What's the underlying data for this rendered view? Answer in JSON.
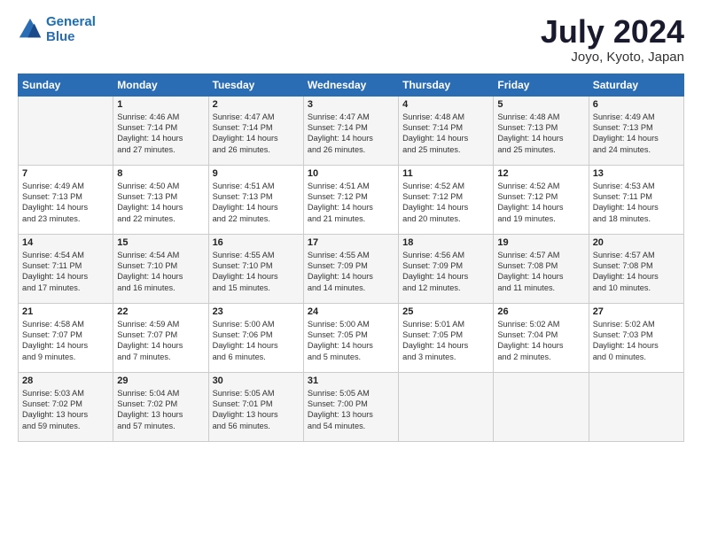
{
  "header": {
    "logo_line1": "General",
    "logo_line2": "Blue",
    "month": "July 2024",
    "location": "Joyo, Kyoto, Japan"
  },
  "days_of_week": [
    "Sunday",
    "Monday",
    "Tuesday",
    "Wednesday",
    "Thursday",
    "Friday",
    "Saturday"
  ],
  "weeks": [
    [
      {
        "day": "",
        "content": ""
      },
      {
        "day": "1",
        "content": "Sunrise: 4:46 AM\nSunset: 7:14 PM\nDaylight: 14 hours\nand 27 minutes."
      },
      {
        "day": "2",
        "content": "Sunrise: 4:47 AM\nSunset: 7:14 PM\nDaylight: 14 hours\nand 26 minutes."
      },
      {
        "day": "3",
        "content": "Sunrise: 4:47 AM\nSunset: 7:14 PM\nDaylight: 14 hours\nand 26 minutes."
      },
      {
        "day": "4",
        "content": "Sunrise: 4:48 AM\nSunset: 7:14 PM\nDaylight: 14 hours\nand 25 minutes."
      },
      {
        "day": "5",
        "content": "Sunrise: 4:48 AM\nSunset: 7:13 PM\nDaylight: 14 hours\nand 25 minutes."
      },
      {
        "day": "6",
        "content": "Sunrise: 4:49 AM\nSunset: 7:13 PM\nDaylight: 14 hours\nand 24 minutes."
      }
    ],
    [
      {
        "day": "7",
        "content": "Sunrise: 4:49 AM\nSunset: 7:13 PM\nDaylight: 14 hours\nand 23 minutes."
      },
      {
        "day": "8",
        "content": "Sunrise: 4:50 AM\nSunset: 7:13 PM\nDaylight: 14 hours\nand 22 minutes."
      },
      {
        "day": "9",
        "content": "Sunrise: 4:51 AM\nSunset: 7:13 PM\nDaylight: 14 hours\nand 22 minutes."
      },
      {
        "day": "10",
        "content": "Sunrise: 4:51 AM\nSunset: 7:12 PM\nDaylight: 14 hours\nand 21 minutes."
      },
      {
        "day": "11",
        "content": "Sunrise: 4:52 AM\nSunset: 7:12 PM\nDaylight: 14 hours\nand 20 minutes."
      },
      {
        "day": "12",
        "content": "Sunrise: 4:52 AM\nSunset: 7:12 PM\nDaylight: 14 hours\nand 19 minutes."
      },
      {
        "day": "13",
        "content": "Sunrise: 4:53 AM\nSunset: 7:11 PM\nDaylight: 14 hours\nand 18 minutes."
      }
    ],
    [
      {
        "day": "14",
        "content": "Sunrise: 4:54 AM\nSunset: 7:11 PM\nDaylight: 14 hours\nand 17 minutes."
      },
      {
        "day": "15",
        "content": "Sunrise: 4:54 AM\nSunset: 7:10 PM\nDaylight: 14 hours\nand 16 minutes."
      },
      {
        "day": "16",
        "content": "Sunrise: 4:55 AM\nSunset: 7:10 PM\nDaylight: 14 hours\nand 15 minutes."
      },
      {
        "day": "17",
        "content": "Sunrise: 4:55 AM\nSunset: 7:09 PM\nDaylight: 14 hours\nand 14 minutes."
      },
      {
        "day": "18",
        "content": "Sunrise: 4:56 AM\nSunset: 7:09 PM\nDaylight: 14 hours\nand 12 minutes."
      },
      {
        "day": "19",
        "content": "Sunrise: 4:57 AM\nSunset: 7:08 PM\nDaylight: 14 hours\nand 11 minutes."
      },
      {
        "day": "20",
        "content": "Sunrise: 4:57 AM\nSunset: 7:08 PM\nDaylight: 14 hours\nand 10 minutes."
      }
    ],
    [
      {
        "day": "21",
        "content": "Sunrise: 4:58 AM\nSunset: 7:07 PM\nDaylight: 14 hours\nand 9 minutes."
      },
      {
        "day": "22",
        "content": "Sunrise: 4:59 AM\nSunset: 7:07 PM\nDaylight: 14 hours\nand 7 minutes."
      },
      {
        "day": "23",
        "content": "Sunrise: 5:00 AM\nSunset: 7:06 PM\nDaylight: 14 hours\nand 6 minutes."
      },
      {
        "day": "24",
        "content": "Sunrise: 5:00 AM\nSunset: 7:05 PM\nDaylight: 14 hours\nand 5 minutes."
      },
      {
        "day": "25",
        "content": "Sunrise: 5:01 AM\nSunset: 7:05 PM\nDaylight: 14 hours\nand 3 minutes."
      },
      {
        "day": "26",
        "content": "Sunrise: 5:02 AM\nSunset: 7:04 PM\nDaylight: 14 hours\nand 2 minutes."
      },
      {
        "day": "27",
        "content": "Sunrise: 5:02 AM\nSunset: 7:03 PM\nDaylight: 14 hours\nand 0 minutes."
      }
    ],
    [
      {
        "day": "28",
        "content": "Sunrise: 5:03 AM\nSunset: 7:02 PM\nDaylight: 13 hours\nand 59 minutes."
      },
      {
        "day": "29",
        "content": "Sunrise: 5:04 AM\nSunset: 7:02 PM\nDaylight: 13 hours\nand 57 minutes."
      },
      {
        "day": "30",
        "content": "Sunrise: 5:05 AM\nSunset: 7:01 PM\nDaylight: 13 hours\nand 56 minutes."
      },
      {
        "day": "31",
        "content": "Sunrise: 5:05 AM\nSunset: 7:00 PM\nDaylight: 13 hours\nand 54 minutes."
      },
      {
        "day": "",
        "content": ""
      },
      {
        "day": "",
        "content": ""
      },
      {
        "day": "",
        "content": ""
      }
    ]
  ]
}
